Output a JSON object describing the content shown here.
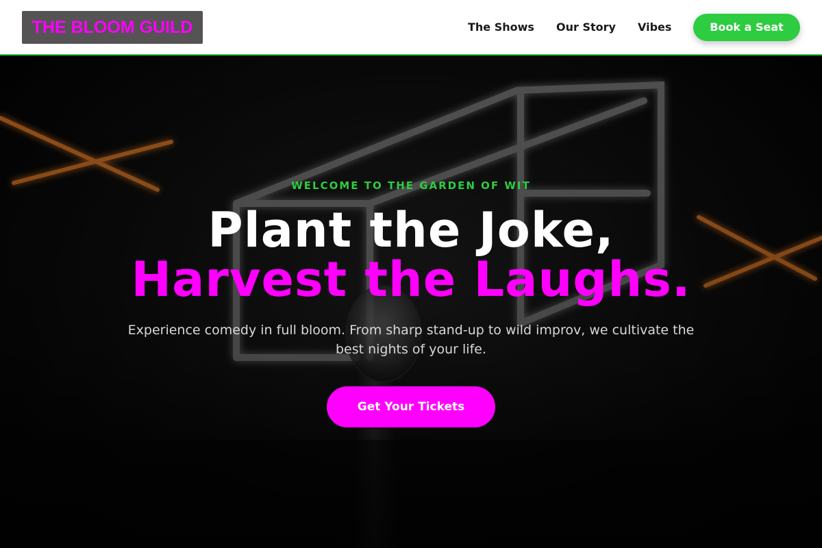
{
  "header": {
    "logo_text": "THE BLOOM GUILD",
    "nav": {
      "shows": "The Shows",
      "story": "Our Story",
      "vibes": "Vibes"
    },
    "book_label": "Book a Seat"
  },
  "hero": {
    "background_icon": "neon-stage-microphone-image",
    "eyebrow": "WELCOME TO THE GARDEN OF WIT",
    "headline_line1": "Plant the Joke,",
    "headline_line2": "Harvest the Laughs.",
    "subtext": "Experience comedy in full bloom. From sharp stand-up to wild improv, we cultivate the best nights of your life.",
    "cta_label": "Get Your Tickets"
  },
  "colors": {
    "brand_magenta": "#ff00ff",
    "accent_green": "#2ecc40",
    "header_bg": "#ffffff",
    "logo_bg": "#555353",
    "hero_bg": "#000000"
  }
}
